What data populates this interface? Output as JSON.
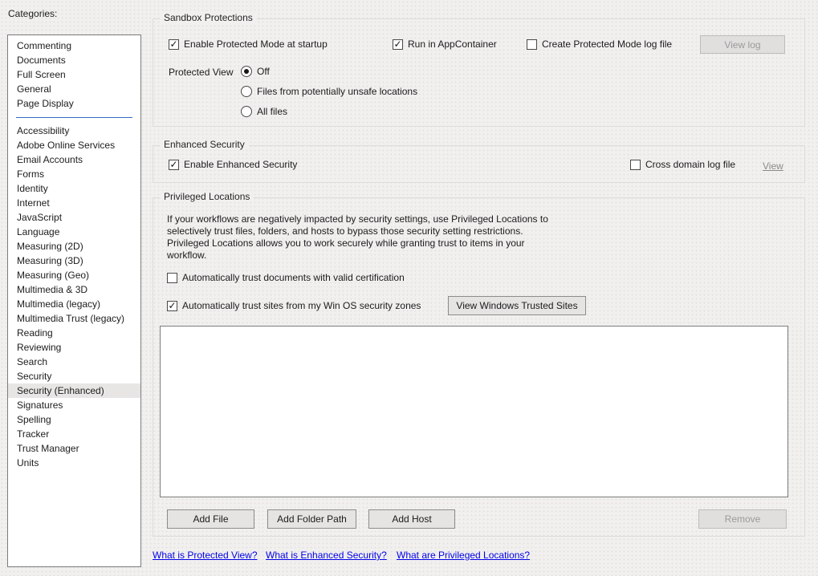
{
  "colors": {
    "page_bg": "#f1f0ef",
    "separator_blue": "#316ac5",
    "link_blue": "#0202e8",
    "selected_item_bg": "#e7e6e5",
    "disabled_text": "#9b9b9b"
  },
  "sidebar": {
    "label": "Categories:",
    "selected_label": "Security (Enhanced)",
    "group1": [
      "Commenting",
      "Documents",
      "Full Screen",
      "General",
      "Page Display"
    ],
    "group2": [
      "Accessibility",
      "Adobe Online Services",
      "Email Accounts",
      "Forms",
      "Identity",
      "Internet",
      "JavaScript",
      "Language",
      "Measuring (2D)",
      "Measuring (3D)",
      "Measuring (Geo)",
      "Multimedia & 3D",
      "Multimedia (legacy)",
      "Multimedia Trust (legacy)",
      "Reading",
      "Reviewing",
      "Search",
      "Security",
      "Security (Enhanced)",
      "Signatures",
      "Spelling",
      "Tracker",
      "Trust Manager",
      "Units"
    ]
  },
  "sandbox": {
    "title": "Sandbox Protections",
    "cb_protected_mode": {
      "label": "Enable Protected Mode at startup",
      "checked": true
    },
    "cb_appcontainer": {
      "label": "Run in AppContainer",
      "checked": true
    },
    "cb_log_file": {
      "label": "Create Protected Mode log file",
      "checked": false
    },
    "view_log_button": "View log",
    "protected_view_label": "Protected View",
    "radio_off": {
      "label": "Off",
      "selected": true
    },
    "radio_unsafe": {
      "label": "Files from potentially unsafe locations",
      "selected": false
    },
    "radio_all": {
      "label": "All files",
      "selected": false
    }
  },
  "enhanced": {
    "title": "Enhanced Security",
    "cb_enable": {
      "label": "Enable Enhanced Security",
      "checked": true
    },
    "cb_cross_domain": {
      "label": "Cross domain log file",
      "checked": false
    },
    "view_link": "View"
  },
  "privileged": {
    "title": "Privileged Locations",
    "description_lines": [
      "If your workflows are negatively impacted by security settings, use Privileged Locations to",
      "selectively trust files, folders, and hosts to bypass those security setting restrictions.",
      "Privileged Locations allows you to work securely while granting trust to items in your",
      "workflow."
    ],
    "cb_trust_docs": {
      "label": "Automatically trust documents with valid certification",
      "checked": false
    },
    "cb_trust_sites": {
      "label": "Automatically trust sites from my Win OS security zones",
      "checked": true
    },
    "view_trusted_sites_button": "View Windows Trusted Sites",
    "add_file_button": "Add File",
    "add_folder_button": "Add Folder Path",
    "add_host_button": "Add Host",
    "remove_button": "Remove"
  },
  "footer": {
    "links": [
      "What is Protected View?",
      "What is Enhanced Security?",
      "What are Privileged Locations?"
    ]
  },
  "icons": {
    "checkbox_check": "✓",
    "radio_dot": "●"
  }
}
